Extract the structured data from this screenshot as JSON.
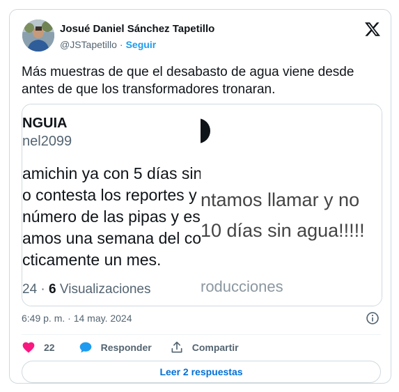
{
  "tweet": {
    "author_name": "Josué Daniel Sánchez Tapetillo",
    "handle": "@JSTapetillo",
    "separator": "·",
    "follow_label": "Seguir",
    "text": "Más muestras de que el desabasto de agua viene desde antes de que los transformadores tronaran.",
    "timestamp": "6:49 p. m. · 14 may. 2024",
    "likes_count": "22",
    "reply_label": "Responder",
    "share_label": "Compartir",
    "read_replies_label": "Leer 2 respuestas"
  },
  "media": {
    "left_name": "NGUIA",
    "left_handle": "nel2099",
    "left_lines": [
      "amichin ya con 5 días sin",
      "o contesta los reportes y",
      "número de las pipas y es",
      "amos una semana del co",
      "cticamente un mes."
    ],
    "left_stats_prefix": "24 · ",
    "left_stats_views": "6",
    "left_stats_suffix": " Visualizaciones",
    "right_logo_letter": "a",
    "right_lines": [
      "ntamos llamar y no",
      "10 días sin agua!!!!!"
    ],
    "right_sub": "roducciones"
  },
  "colors": {
    "accent": "#1d9bf0",
    "like_heart": "#f91880",
    "reply_bubble": "#1d9bf0",
    "link": "#006fd6"
  },
  "icons": {
    "brand": "x-logo-icon",
    "info": "info-icon",
    "like": "heart-icon",
    "reply": "speech-bubble-icon",
    "share": "share-upload-icon"
  }
}
